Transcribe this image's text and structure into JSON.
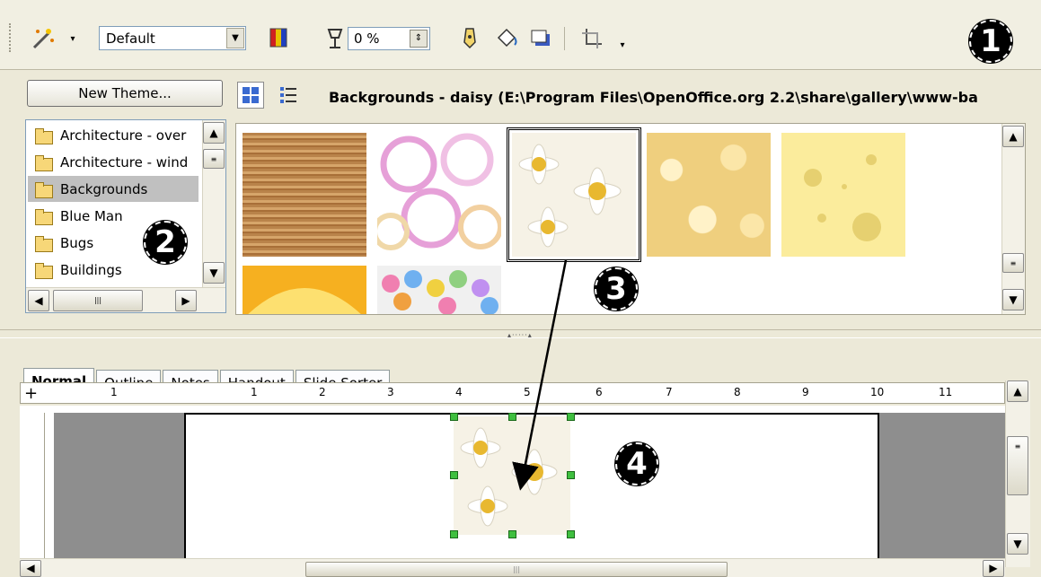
{
  "toolbar": {
    "style_value": "Default",
    "transparency_value": "0 %",
    "icons": [
      "magic-wand-icon",
      "dropdown-arrow-icon",
      "color-icon",
      "transparency-icon",
      "pencil-icon",
      "fill-bucket-icon",
      "shadow-icon",
      "crop-icon",
      "overflow-icon"
    ]
  },
  "callouts": {
    "c1": "1",
    "c2": "2",
    "c3": "3",
    "c4": "4"
  },
  "gallery": {
    "new_theme_label": "New Theme...",
    "title": "Backgrounds - daisy (E:\\Program Files\\OpenOffice.org 2.2\\share\\gallery\\www-ba",
    "themes": [
      "Architecture - over",
      "Architecture - wind",
      "Backgrounds",
      "Blue Man",
      "Bugs",
      "Buildings"
    ],
    "selected_theme": "Backgrounds",
    "thumbnails": [
      "wood",
      "rings",
      "daisy",
      "popcorn",
      "cheese",
      "orange",
      "candy"
    ],
    "selected_thumbnail": "daisy"
  },
  "tabs": [
    "Normal",
    "Outline",
    "Notes",
    "Handout",
    "Slide Sorter"
  ],
  "active_tab": "Normal",
  "ruler": {
    "left_label": "1",
    "labels": [
      "1",
      "2",
      "3",
      "4",
      "5",
      "6",
      "7",
      "8",
      "9",
      "10",
      "11"
    ]
  },
  "colors": {
    "selection_handle": "#3fbf3f",
    "slide_margin": "#8e8e8e"
  }
}
